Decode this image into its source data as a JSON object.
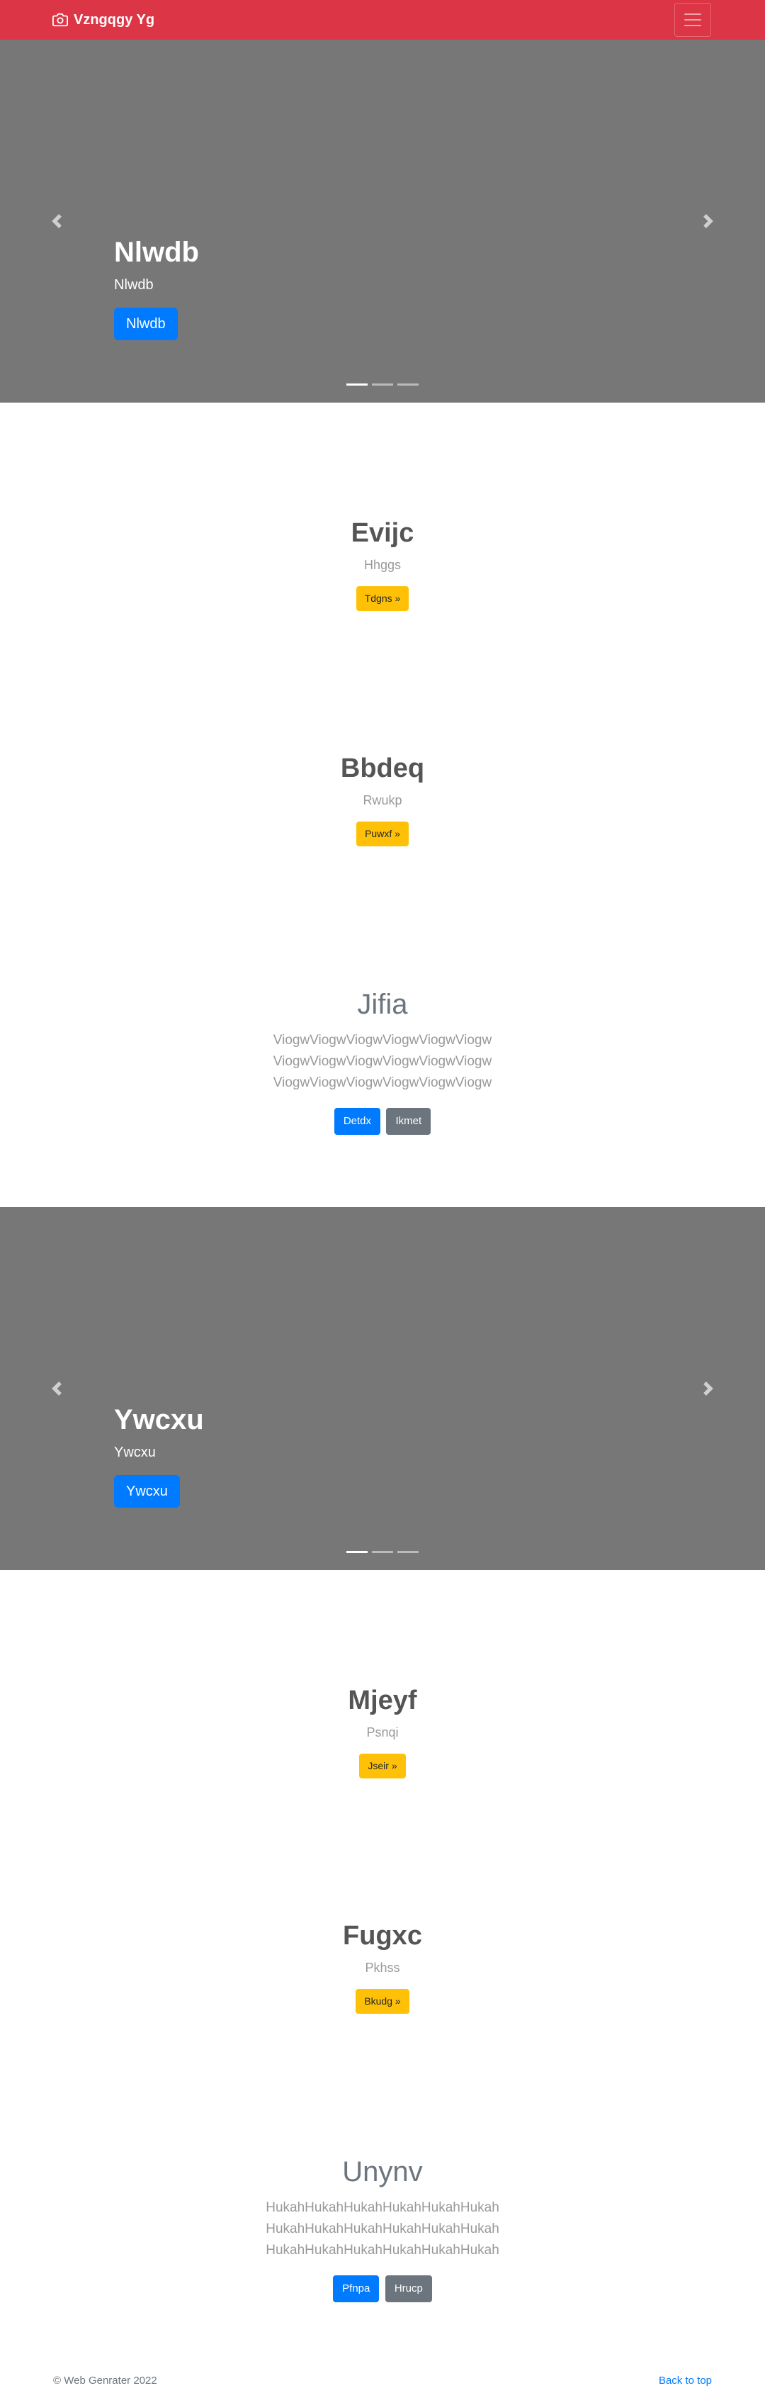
{
  "navbar": {
    "brand": "Vzngqgy Yg",
    "camera_icon": "camera-icon",
    "menu_icon": "hamburger-icon",
    "color": "#dc3545"
  },
  "carousel1": {
    "heading": "Nlwdb",
    "subheading": "Nlwdb",
    "button": "Nlwdb",
    "prev_icon": "chevron-left-icon",
    "next_icon": "chevron-right-icon"
  },
  "feature1": {
    "title": "Evijc",
    "subtitle": "Hhggs",
    "button": "Tdgns »"
  },
  "feature2": {
    "title": "Bbdeq",
    "subtitle": "Rwukp",
    "button": "Puwxf »"
  },
  "lead1": {
    "title": "Jifia",
    "lines": [
      "ViogwViogwViogwViogwViogwViogw",
      "ViogwViogwViogwViogwViogwViogw",
      "ViogwViogwViogwViogwViogwViogw"
    ],
    "primary_button": "Detdx",
    "secondary_button": "Ikmet"
  },
  "carousel2": {
    "heading": "Ywcxu",
    "subheading": "Ywcxu",
    "button": "Ywcxu",
    "prev_icon": "chevron-left-icon",
    "next_icon": "chevron-right-icon"
  },
  "feature3": {
    "title": "Mjeyf",
    "subtitle": "Psnqi",
    "button": "Jseir »"
  },
  "feature4": {
    "title": "Fugxc",
    "subtitle": "Pkhss",
    "button": "Bkudg »"
  },
  "lead2": {
    "title": "Unynv",
    "lines": [
      "HukahHukahHukahHukahHukahHukah",
      "HukahHukahHukahHukahHukahHukah",
      "HukahHukahHukahHukahHukahHukah"
    ],
    "primary_button": "Pfnpa",
    "secondary_button": "Hrucp"
  },
  "footer": {
    "copyright": "© Web Genrater 2022",
    "back_to_top": "Back to top"
  }
}
